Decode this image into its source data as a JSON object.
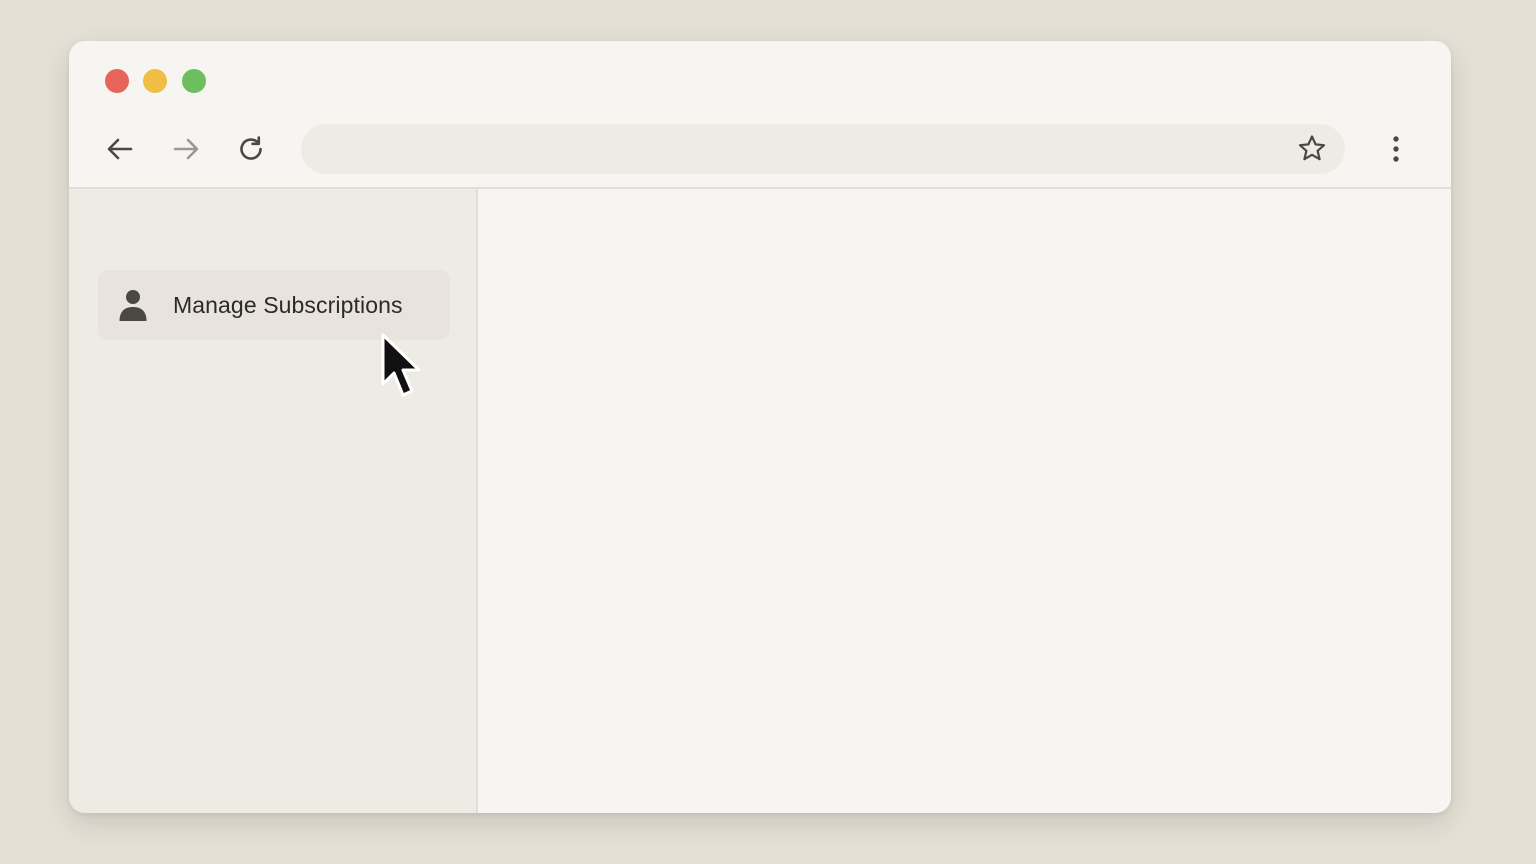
{
  "window": {
    "traffic_lights": {
      "close_color": "#e5655b",
      "minimize_color": "#f0bd45",
      "maximize_color": "#6dbe5f"
    }
  },
  "toolbar": {
    "back_icon": "arrow-left-icon",
    "forward_icon": "arrow-right-icon",
    "reload_icon": "reload-icon",
    "address": {
      "value": "",
      "placeholder": ""
    },
    "bookmark_icon": "star-icon",
    "menu_icon": "kebab-menu-icon"
  },
  "sidebar": {
    "items": [
      {
        "label": "Manage Subscriptions",
        "icon": "person-icon",
        "hovered": true
      }
    ]
  },
  "colors": {
    "background": "#e4e0d6",
    "window": "#f7f5f1",
    "sidebar": "#eeebe5",
    "sidebar_item_hover": "#e8e4dd",
    "text": "#2b2a27",
    "icon": "#4a4844"
  }
}
